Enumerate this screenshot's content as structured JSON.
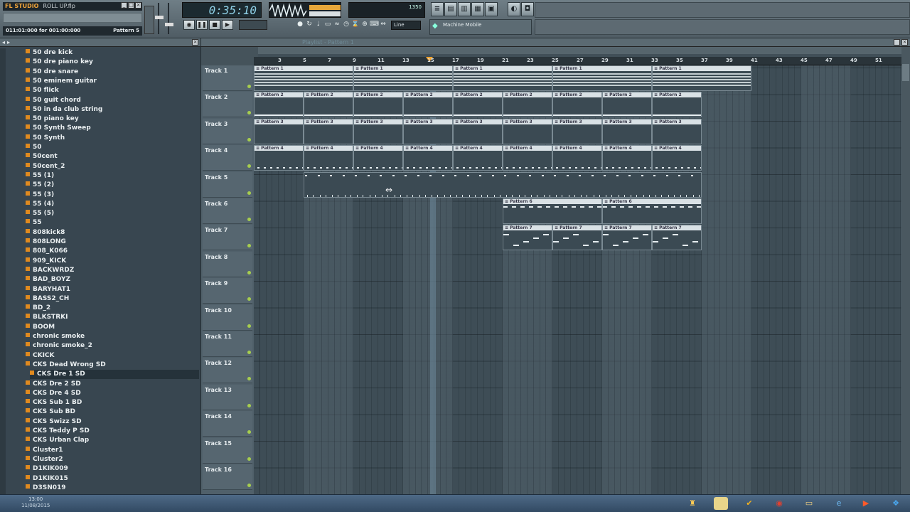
{
  "app": {
    "logo": "FL STUDIO",
    "file": "ROLL UP.flp"
  },
  "hint_bar": "",
  "song_position": {
    "left": "011:01:000 for 001:00:000",
    "right": "Pattern 5"
  },
  "time_display": "0:35:10",
  "tempo": "",
  "cpu": {
    "left": "",
    "right": "1350"
  },
  "snap": "Line",
  "online": {
    "line1": "",
    "line2": "Machine Mobile"
  },
  "browser": {
    "title": "",
    "items": [
      "50 dre kick",
      "50 dre piano key",
      "50 dre snare",
      "50 eminem guitar",
      "50 flick",
      "50 guit chord",
      "50 in da club string",
      "50 piano key",
      "50 Synth Sweep",
      "50 Synth",
      "50",
      "50cent",
      "50cent_2",
      "55 (1)",
      "55 (2)",
      "55 (3)",
      "55 (4)",
      "55 (5)",
      "55",
      "808kick8",
      "808LONG",
      "808_K066",
      "909_KICK",
      "BACKWRDZ",
      "BAD_BOYZ",
      "BARYHAT1",
      "BASS2_CH",
      "BD_2",
      "BLKSTRKI",
      "BOOM",
      "chronic smoke",
      "chronic smoke_2",
      "CKICK",
      "CKS Dead Wrong SD",
      "CKS Dre 1 SD",
      "CKS Dre 2 SD",
      "CKS Dre 4 SD",
      "CKS Sub 1 BD",
      "CKS Sub BD",
      "CKS Swizz SD",
      "CKS Teddy P SD",
      "CKS Urban Clap",
      "Cluster1",
      "Cluster2",
      "D1KIK009",
      "D1KIK015",
      "D3SN019"
    ]
  },
  "playlist": {
    "title": "Playlist - Pattern 1",
    "ruler": [
      "3",
      "5",
      "7",
      "9",
      "11",
      "13",
      "15",
      "17",
      "19",
      "21",
      "23",
      "25",
      "27",
      "29",
      "31",
      "33",
      "35",
      "37",
      "39",
      "41",
      "43",
      "45",
      "47",
      "49",
      "51"
    ],
    "tracks": [
      "Track 1",
      "Track 2",
      "Track 3",
      "Track 4",
      "Track 5",
      "Track 6",
      "Track 7",
      "Track 8",
      "Track 9",
      "Track 10",
      "Track 11",
      "Track 12",
      "Track 13",
      "Track 14",
      "Track 15",
      "Track 16"
    ],
    "pattern_labels": {
      "p1": "Pattern 1",
      "p2": "Pattern 2",
      "p3": "Pattern 3",
      "p4": "Pattern 4",
      "p6": "Pattern 6",
      "p7": "Pattern 7"
    }
  },
  "taskbar": {
    "time": "13:00",
    "date": "11/08/2015"
  }
}
